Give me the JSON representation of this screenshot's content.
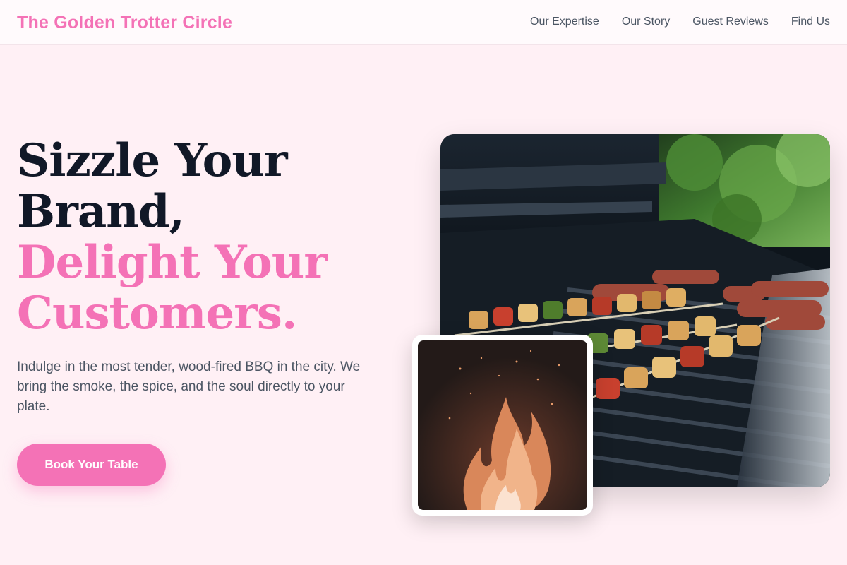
{
  "brand": {
    "name": "The Golden Trotter Circle"
  },
  "nav": {
    "links": [
      "Our Expertise",
      "Our Story",
      "Guest Reviews",
      "Find Us"
    ]
  },
  "hero": {
    "headline_line1": "Sizzle Your",
    "headline_line2": "Brand,",
    "headline_line3": "Delight Your",
    "headline_line4": "Customers.",
    "tagline": "Indulge in the most tender, wood-fired BBQ in the city. We bring the smoke, the spice, and the soul directly to your plate.",
    "cta_label": "Book Your Table"
  },
  "images": {
    "main": "grill-skewers-photo",
    "inset": "fire-flames-photo"
  },
  "colors": {
    "accent": "#f472b6",
    "background": "#fff0f5",
    "headline": "#111827",
    "body_text": "#4b5563"
  }
}
